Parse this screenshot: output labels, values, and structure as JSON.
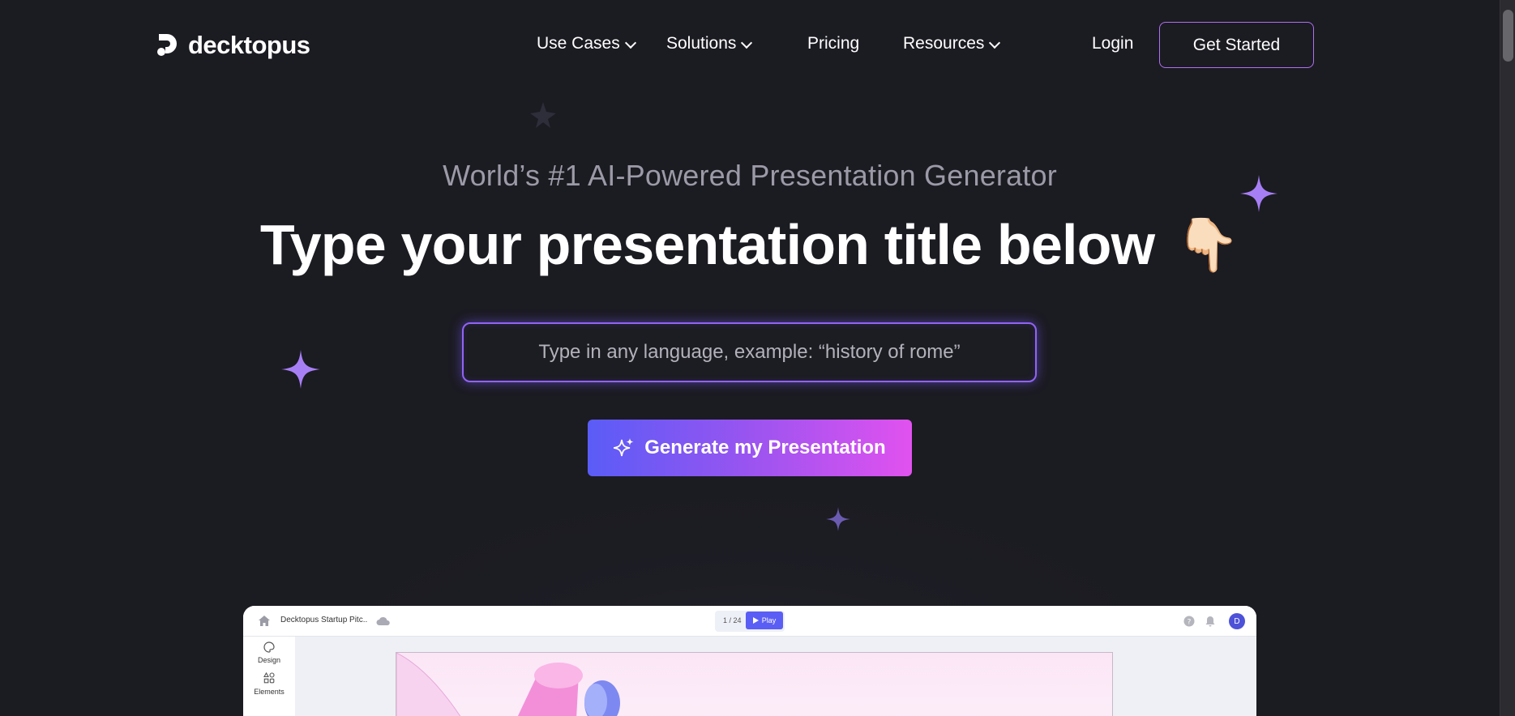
{
  "nav": {
    "brand": "decktopus",
    "items": [
      {
        "label": "Use Cases",
        "dropdown": true
      },
      {
        "label": "Solutions",
        "dropdown": true
      },
      {
        "label": "Pricing",
        "dropdown": false
      },
      {
        "label": "Resources",
        "dropdown": true
      }
    ],
    "login": "Login",
    "get_started": "Get Started"
  },
  "hero": {
    "subtitle": "World’s #1 AI-Powered Presentation Generator",
    "headline": "Type your presentation title below",
    "headline_emoji": "👇🏻",
    "input_placeholder": "Type in any language, example: “history of rome”",
    "input_value": "",
    "generate_label": "Generate my Presentation"
  },
  "preview": {
    "doc_title": "Decktopus Startup Pitc..",
    "pager": "1 / 24",
    "play_label": "Play",
    "avatar_initial": "D",
    "sidebar": [
      {
        "label": "Design",
        "icon": "palette-icon"
      },
      {
        "label": "Elements",
        "icon": "shapes-icon"
      }
    ]
  },
  "colors": {
    "background": "#1b1b22",
    "accent_purple": "#9163f5",
    "gradient_start": "#5a5cf7",
    "gradient_end": "#e152ef",
    "sparkle": "#a77ff5"
  }
}
